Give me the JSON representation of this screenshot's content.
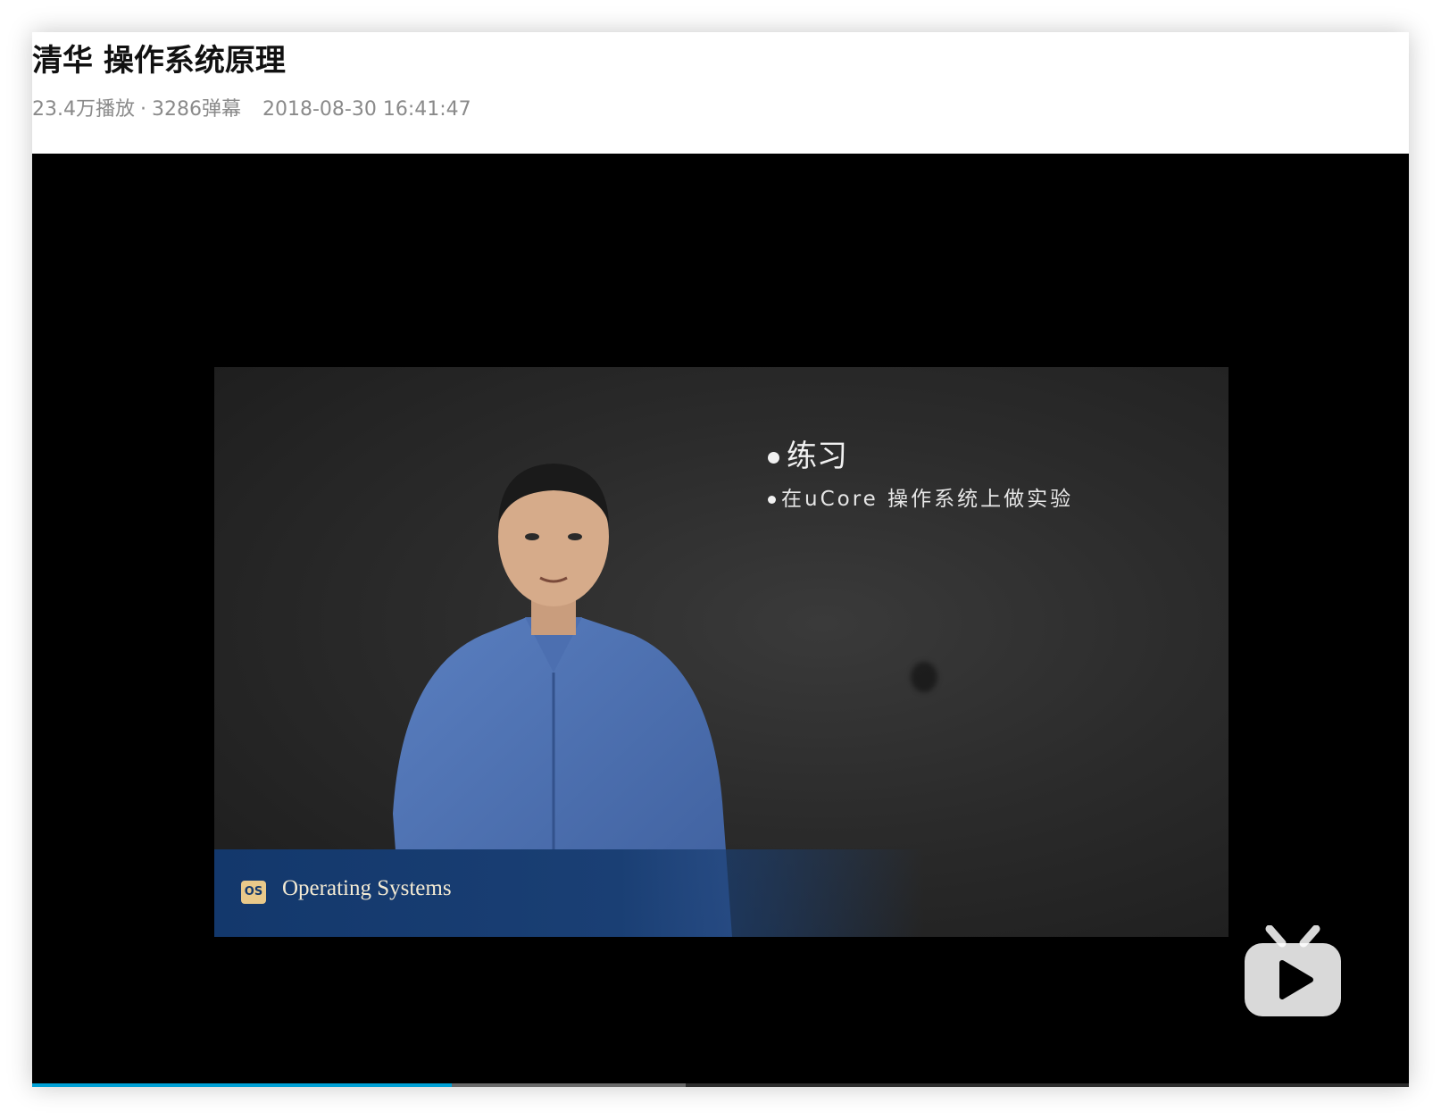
{
  "video": {
    "title": "清华 操作系统原理",
    "views": "23.4万播放",
    "separator": "·",
    "danmaku": "3286弹幕",
    "upload_time": "2018-08-30 16:41:47"
  },
  "slide": {
    "bullet_main": "练习",
    "bullet_sub": "在uCore 操作系统上做实验",
    "banner_logo": "OS",
    "banner_text": "Operating Systems"
  },
  "player": {
    "progress_fraction": 0.305,
    "buffered_fraction": 0.475,
    "progress_color": "#00a1d6",
    "play_icon": "bilibili-tv-play-icon"
  }
}
